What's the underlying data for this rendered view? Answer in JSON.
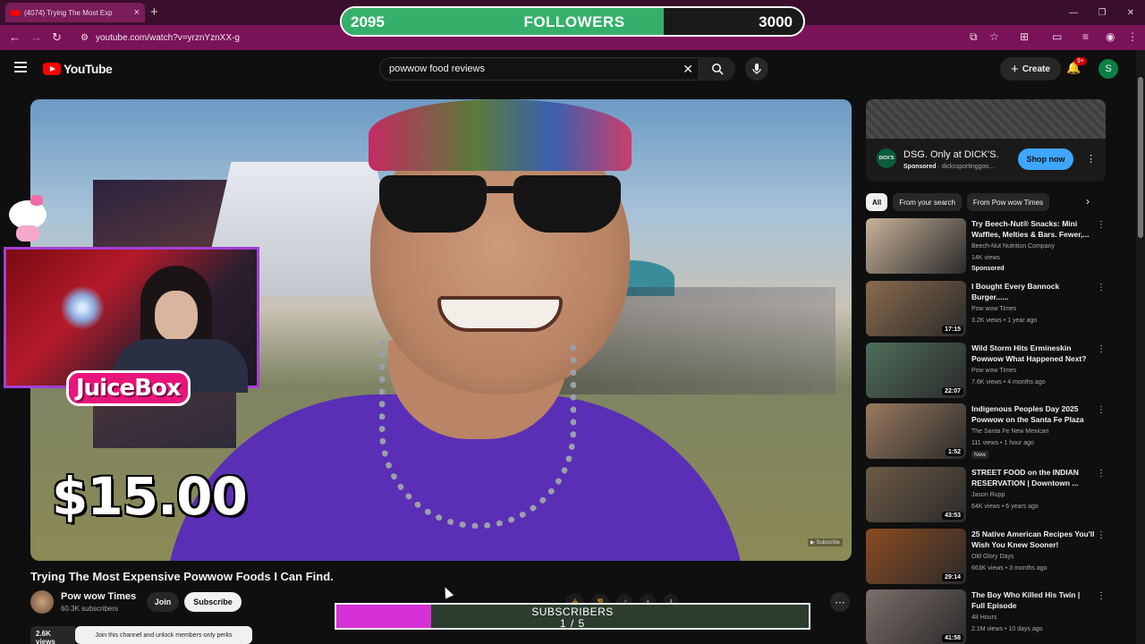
{
  "browser": {
    "tab_title": "(4074) Trying The Most Exp",
    "url": "youtube.com/watch?v=yrznYznXX-g",
    "new_tab_glyph": "+",
    "close_glyph": "×"
  },
  "followers_goal": {
    "current": "2095",
    "label": "FOLLOWERS",
    "goal": "3000",
    "progress": 0.698
  },
  "youtube": {
    "logo_text": "YouTube",
    "search_value": "powwow food reviews",
    "create_label": "Create",
    "notifications_badge": "9+",
    "avatar_letter": "S"
  },
  "video": {
    "price_overlay": "$15.00",
    "streamer_name": "JuiceBox",
    "title": "Trying The Most Expensive Powwow Foods I Can Find.",
    "channel": "Pow wow Times",
    "subscribers": "60.3K subscribers",
    "join_label": "Join",
    "subscribe_label": "Subscribe",
    "join_tooltip": "Join this channel and unlock members-only perks",
    "views": "2.6K views"
  },
  "subscribers_goal": {
    "label": "SUBSCRIBERS",
    "count": "1 / 5",
    "progress": 0.2
  },
  "ad": {
    "title": "DSG. Only at DICK'S.",
    "sponsored": "Sponsored",
    "domain": "dickssportinggoo...",
    "cta": "Shop now",
    "logo_text": "DICK'S"
  },
  "chips": [
    "All",
    "From your search",
    "From Pow wow Times"
  ],
  "recommendations": [
    {
      "title": "Try Beech-Nut® Snacks: Mini Waffles, Melties & Bars. Fewer,...",
      "channel": "Beech-Nut Nutrition Company",
      "meta": "14K views",
      "extra": "Sponsored",
      "duration": "",
      "thumb_color": "#c9b29a"
    },
    {
      "title": "I Bought Every Bannock Burger......",
      "channel": "Pow wow Times",
      "meta": "3.2K views • 1 year ago",
      "extra": "",
      "duration": "17:15",
      "thumb_color": "#8a6b4d"
    },
    {
      "title": "Wild Storm Hits Ermineskin Powwow What Happened Next?",
      "channel": "Pow wow Times",
      "meta": "7.6K views • 4 months ago",
      "extra": "",
      "duration": "22:07",
      "thumb_color": "#4f6e5a"
    },
    {
      "title": "Indigenous Peoples Day 2025 Powwow on the Santa Fe Plaza",
      "channel": "The Santa Fe New Mexican",
      "meta": "111 views • 1 hour ago",
      "extra": "New",
      "duration": "1:52",
      "thumb_color": "#9a7a5f"
    },
    {
      "title": "STREET FOOD on the INDIAN RESERVATION | Downtown ...",
      "channel": "Jason Rupp",
      "meta": "64K views • 6 years ago",
      "extra": "",
      "duration": "43:53",
      "thumb_color": "#6d5a45"
    },
    {
      "title": "25 Native American Recipes You'll Wish You Knew Sooner!",
      "channel": "Old Glory Days",
      "meta": "663K views • 3 months ago",
      "extra": "",
      "duration": "29:14",
      "thumb_color": "#8c4b22"
    },
    {
      "title": "The Boy Who Killed His Twin | Full Episode",
      "channel": "48 Hours",
      "meta": "2.1M views • 10 days ago",
      "extra": "",
      "duration": "41:58",
      "thumb_color": "#7c6f6a"
    }
  ]
}
